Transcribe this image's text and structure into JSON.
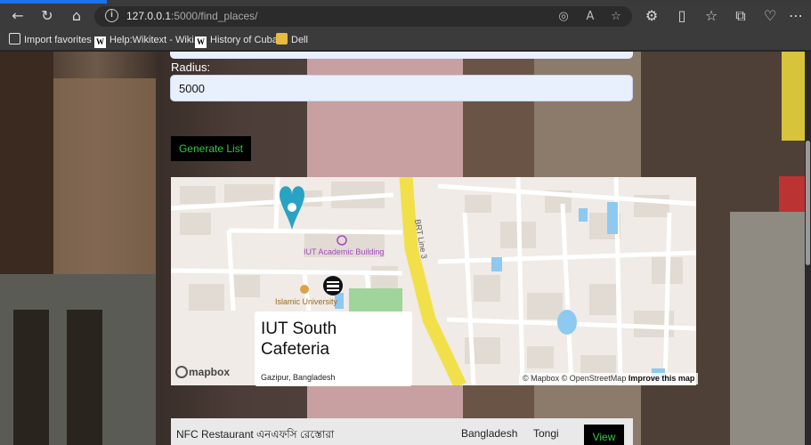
{
  "browser": {
    "url_host": "127.0.0.1",
    "url_rest": ":5000/find_places/",
    "favorites": [
      {
        "label": "Import favorites",
        "icon": "import-icon"
      },
      {
        "label": "Help:Wikitext - Wiki...",
        "icon": "wikipedia-icon"
      },
      {
        "label": "History of Cuba",
        "icon": "wikipedia-icon"
      },
      {
        "label": "Dell",
        "icon": "folder-icon"
      }
    ]
  },
  "form": {
    "radius_label": "Radius:",
    "radius_value": "5000",
    "generate_label": "Generate List"
  },
  "map": {
    "labels": {
      "academic": "IUT Academic Building",
      "university": "Islamic University",
      "road": "BRT Line 3"
    },
    "popup": {
      "title": "IUT South Cafeteria",
      "subtitle": "Gazipur, Bangladesh"
    },
    "logo": "mapbox",
    "attribution": "© Mapbox © OpenStreetMap",
    "improve": "Improve this map"
  },
  "results": [
    {
      "name": "NFC Restaurant এনএফসি রেস্তোরা",
      "country": "Bangladesh",
      "city": "Tongi",
      "action": "View"
    }
  ],
  "colors": {
    "button_bg": "#000000",
    "button_text": "#2ecc40",
    "input_bg": "#e8f0fe",
    "road_yellow": "#f1e04a",
    "water": "#8ec9f2",
    "park": "#9fd49a",
    "marker": "#29a3c4"
  }
}
